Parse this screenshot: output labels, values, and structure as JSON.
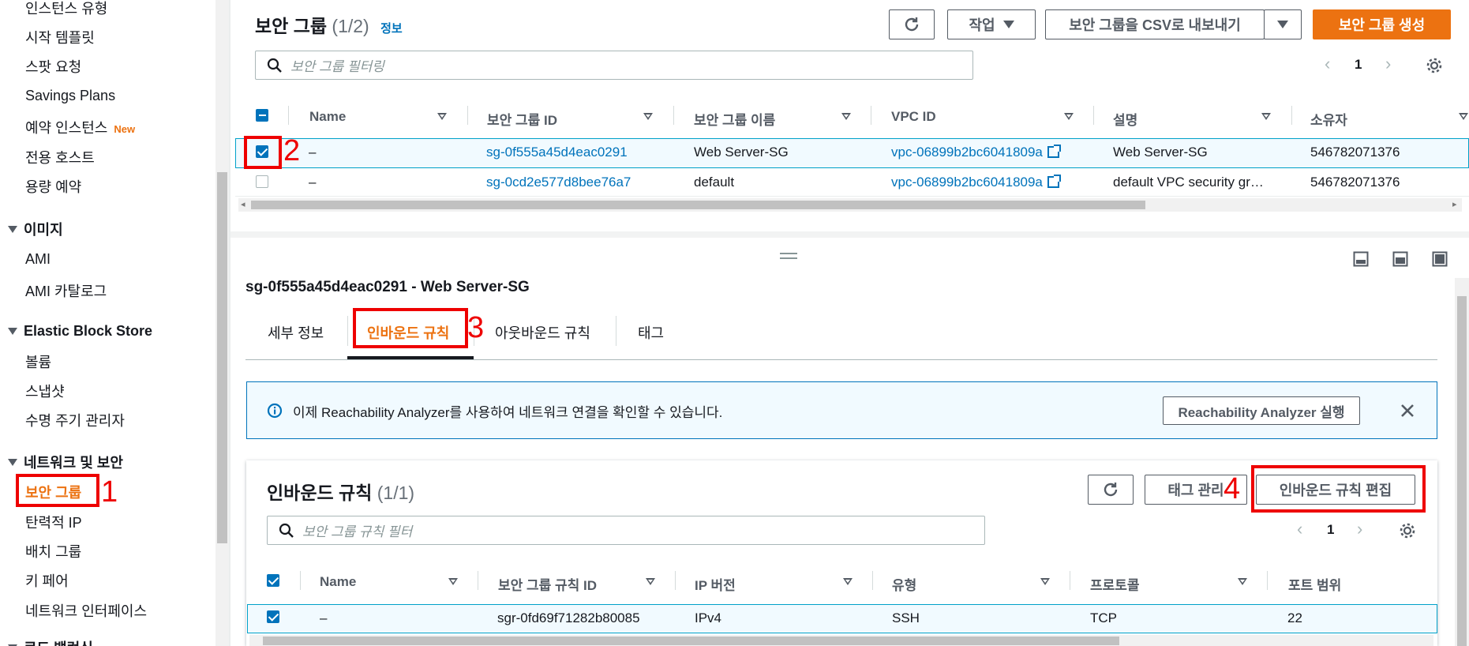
{
  "sidebar": {
    "items": [
      {
        "label": "인스턴스 유형"
      },
      {
        "label": "시작 템플릿"
      },
      {
        "label": "스팟 요청"
      },
      {
        "label": "Savings Plans"
      },
      {
        "label": "예약 인스턴스",
        "badge": "New"
      },
      {
        "label": "전용 호스트"
      },
      {
        "label": "용량 예약"
      }
    ],
    "sections": [
      {
        "title": "이미지",
        "items": [
          "AMI",
          "AMI 카탈로그"
        ]
      },
      {
        "title": "Elastic Block Store",
        "items": [
          "볼륨",
          "스냅샷",
          "수명 주기 관리자"
        ]
      },
      {
        "title": "네트워크 및 보안",
        "items": [
          "보안 그룹",
          "탄력적 IP",
          "배치 그룹",
          "키 페어",
          "네트워크 인터페이스"
        ]
      }
    ],
    "cut_section": "로드 밸런싱"
  },
  "sg_panel": {
    "title": "보안 그룹",
    "count": "(1/2)",
    "info_link": "정보",
    "actions_label": "작업",
    "export_label": "보안 그룹을 CSV로 내보내기",
    "create_label": "보안 그룹 생성",
    "filter_placeholder": "보안 그룹 필터링",
    "page": "1",
    "columns": [
      "Name",
      "보안 그룹 ID",
      "보안 그룹 이름",
      "VPC ID",
      "설명",
      "소유자"
    ],
    "rows": [
      {
        "name": "–",
        "id": "sg-0f555a45d4eac0291",
        "group_name": "Web Server-SG",
        "vpc": "vpc-06899b2bc6041809a",
        "desc": "Web Server-SG",
        "owner": "546782071376",
        "selected": true
      },
      {
        "name": "–",
        "id": "sg-0cd2e577d8bee76a7",
        "group_name": "default",
        "vpc": "vpc-06899b2bc6041809a",
        "desc": "default VPC security gr…",
        "owner": "546782071376",
        "selected": false
      }
    ]
  },
  "detail": {
    "heading": "sg-0f555a45d4eac0291 - Web Server-SG",
    "tabs": [
      "세부 정보",
      "인바운드 규칙",
      "아웃바운드 규칙",
      "태그"
    ],
    "active_tab": "인바운드 규칙",
    "banner_text": "이제 Reachability Analyzer를 사용하여 네트워크 연결을 확인할 수 있습니다.",
    "banner_button": "Reachability Analyzer 실행",
    "inbound": {
      "title": "인바운드 규칙",
      "count": "(1/1)",
      "manage_tags": "태그 관리",
      "edit_rules": "인바운드 규칙 편집",
      "filter_placeholder": "보안 그룹 규칙 필터",
      "page": "1",
      "columns": [
        "Name",
        "보안 그룹 규칙 ID",
        "IP 버전",
        "유형",
        "프로토콜",
        "포트 범위"
      ],
      "rows": [
        {
          "name": "–",
          "id": "sgr-0fd69f71282b80085",
          "ip": "IPv4",
          "type": "SSH",
          "protocol": "TCP",
          "port": "22"
        }
      ]
    }
  },
  "annotations": [
    "1",
    "2",
    "3",
    "4"
  ],
  "colors": {
    "accent": "#ec7211",
    "link": "#0073bb",
    "annotation": "#e00000"
  }
}
